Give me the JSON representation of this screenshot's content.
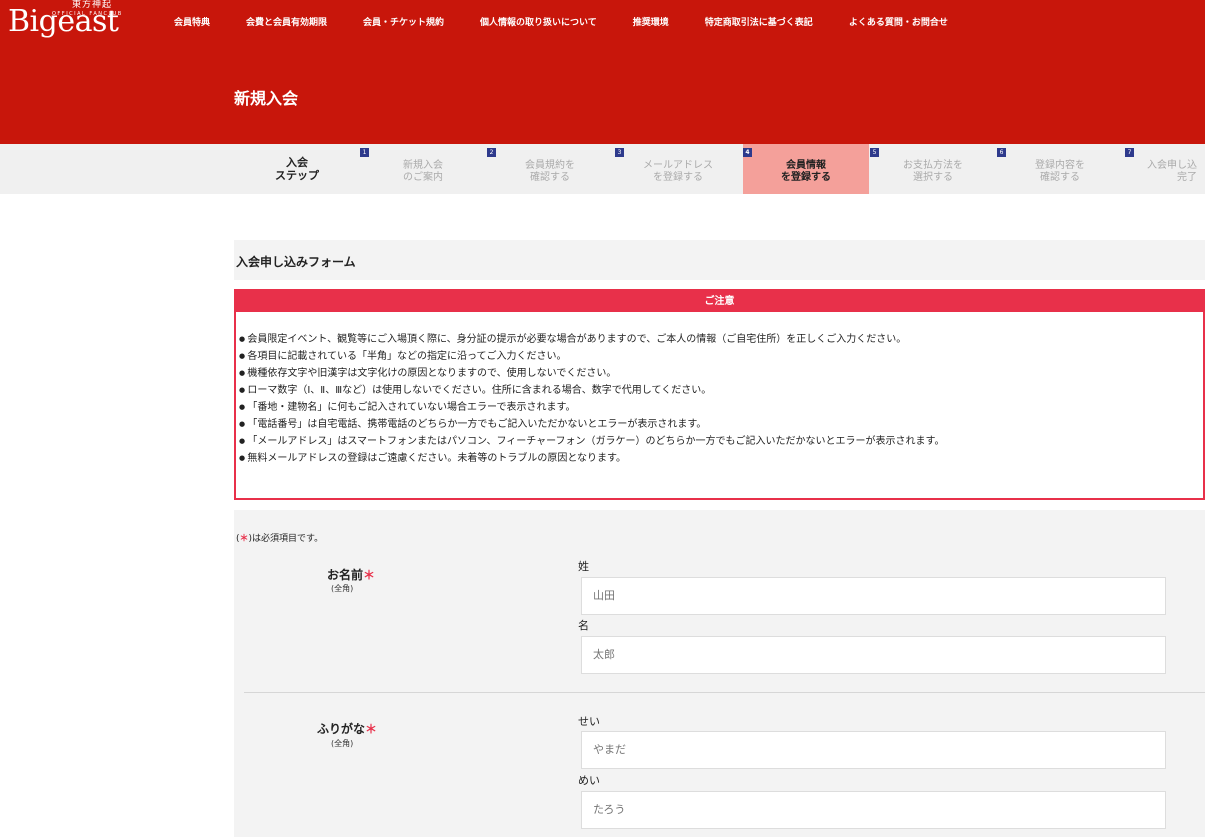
{
  "logo": {
    "kanji": "東方神起",
    "tagline": "OFFICIAL FANCLUB",
    "name": "Bigeast"
  },
  "nav": [
    "会員特典",
    "会費と会員有効期限",
    "会員・チケット規約",
    "個人情報の取り扱いについて",
    "推奨環境",
    "特定商取引法に基づく表記",
    "よくある質問・お問合せ"
  ],
  "page_title": "新規入会",
  "steps": {
    "header": [
      "入会",
      "ステップ"
    ],
    "items": [
      {
        "num": "1",
        "line1": "新規入会",
        "line2": "のご案内"
      },
      {
        "num": "2",
        "line1": "会員規約を",
        "line2": "確認する"
      },
      {
        "num": "3",
        "line1": "メールアドレス",
        "line2": "を登録する"
      },
      {
        "num": "4",
        "line1": "会員情報",
        "line2": "を登録する"
      },
      {
        "num": "5",
        "line1": "お支払方法を",
        "line2": "選択する"
      },
      {
        "num": "6",
        "line1": "登録内容を",
        "line2": "確認する"
      },
      {
        "num": "7",
        "line1": "入会申し込",
        "line2": "完了"
      }
    ],
    "active_step": 4
  },
  "form_title": "入会申し込みフォーム",
  "notice": {
    "title": "ご注意",
    "items": [
      "会員限定イベント、観覧等にご入場頂く際に、身分証の提示が必要な場合がありますので、ご本人の情報（ご自宅住所）を正しくご入力ください。",
      "各項目に記載されている「半角」などの指定に沿ってご入力ください。",
      "機種依存文字や旧漢字は文字化けの原因となりますので、使用しないでください。",
      "ローマ数字（Ⅰ、Ⅱ、Ⅲなど）は使用しないでください。住所に含まれる場合、数字で代用してください。",
      "「番地・建物名」に何もご記入されていない場合エラーで表示されます。",
      "「電話番号」は自宅電話、携帯電話のどちらか一方でもご記入いただかないとエラーが表示されます。",
      "「メールアドレス」はスマートフォンまたはパソコン、フィーチャーフォン（ガラケー）のどちらか一方でもご記入いただかないとエラーが表示されます。",
      "無料メールアドレスの登録はご遠慮ください。未着等のトラブルの原因となります。"
    ]
  },
  "required_note": {
    "open": "(",
    "mark": "＊",
    "rest": ")は必須項目です。"
  },
  "fields": {
    "name": {
      "label": "お名前",
      "required_mark": "＊",
      "sub": "(全角)",
      "last_label": "姓",
      "last_placeholder": "山田",
      "first_label": "名",
      "first_placeholder": "太郎"
    },
    "kana": {
      "label": "ふりがな",
      "required_mark": "＊",
      "sub": "(全角)",
      "last_label": "せい",
      "last_placeholder": "やまだ",
      "first_label": "めい",
      "first_placeholder": "たろう"
    }
  },
  "colors": {
    "header": "#c8160b",
    "accent": "#e8304a",
    "active_step": "#f4a09a",
    "step_num": "#2e3a8c"
  }
}
